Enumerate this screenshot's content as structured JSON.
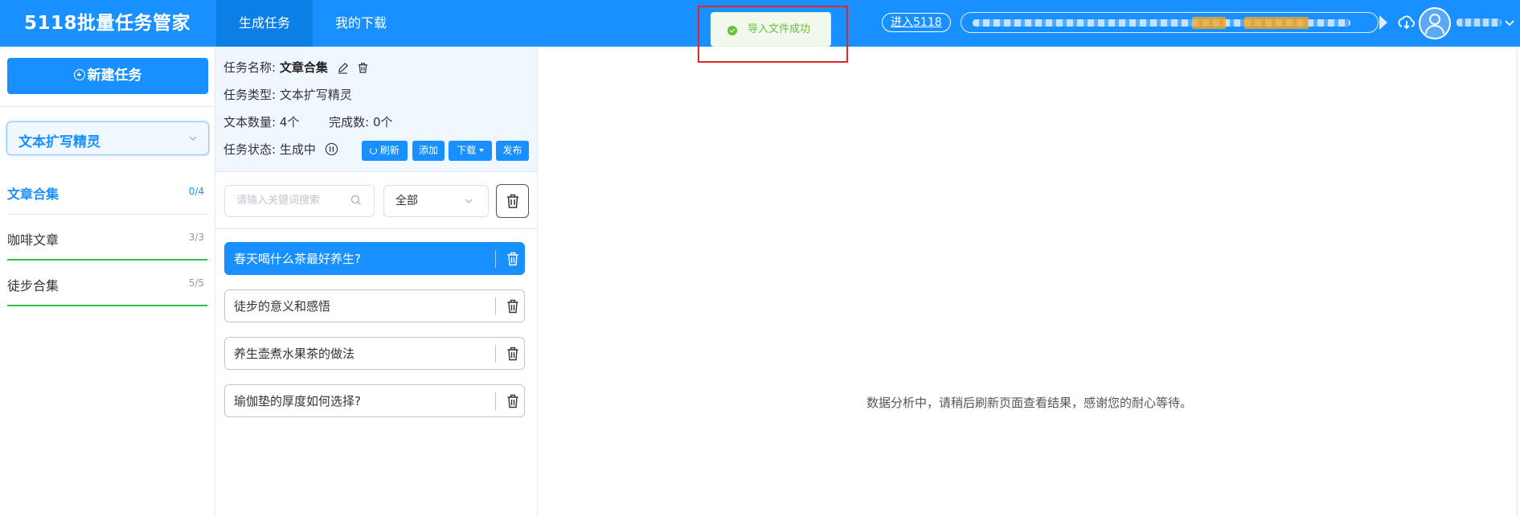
{
  "header": {
    "logo": "5118批量任务管家",
    "tabs": [
      {
        "label": "生成任务",
        "active": true
      },
      {
        "label": "我的下载",
        "active": false
      }
    ],
    "enter_label": "进入5118",
    "accent_color": "#1890ff"
  },
  "toast": {
    "message": "导入文件成功",
    "color": "#67c23a"
  },
  "sidebar": {
    "new_task_label": "新建任务",
    "type_select": "文本扩写精灵",
    "tasks": [
      {
        "name": "文章合集",
        "count": "0/4",
        "active": true
      },
      {
        "name": "咖啡文章",
        "count": "3/3",
        "active": false
      },
      {
        "name": "徒步合集",
        "count": "5/5",
        "active": false
      }
    ]
  },
  "task_info": {
    "name_label": "任务名称:",
    "name_value": "文章合集",
    "type_label": "任务类型:",
    "type_value": "文本扩写精灵",
    "count_label": "文本数量:",
    "count_value": "4个",
    "done_label": "完成数:",
    "done_value": "0个",
    "status_label": "任务状态:",
    "status_value": "生成中",
    "buttons": {
      "refresh": "刷新",
      "add": "添加",
      "download": "下载",
      "publish": "发布"
    }
  },
  "filter": {
    "search_placeholder": "请输入关键词搜索",
    "select_value": "全部"
  },
  "articles": [
    {
      "title": "春天喝什么茶最好养生?",
      "active": true
    },
    {
      "title": "徒步的意义和感悟",
      "active": false
    },
    {
      "title": "养生壶煮水果茶的做法",
      "active": false
    },
    {
      "title": "瑜伽垫的厚度如何选择?",
      "active": false
    }
  ],
  "main": {
    "message": "数据分析中，请稍后刷新页面查看结果，感谢您的耐心等待。"
  }
}
